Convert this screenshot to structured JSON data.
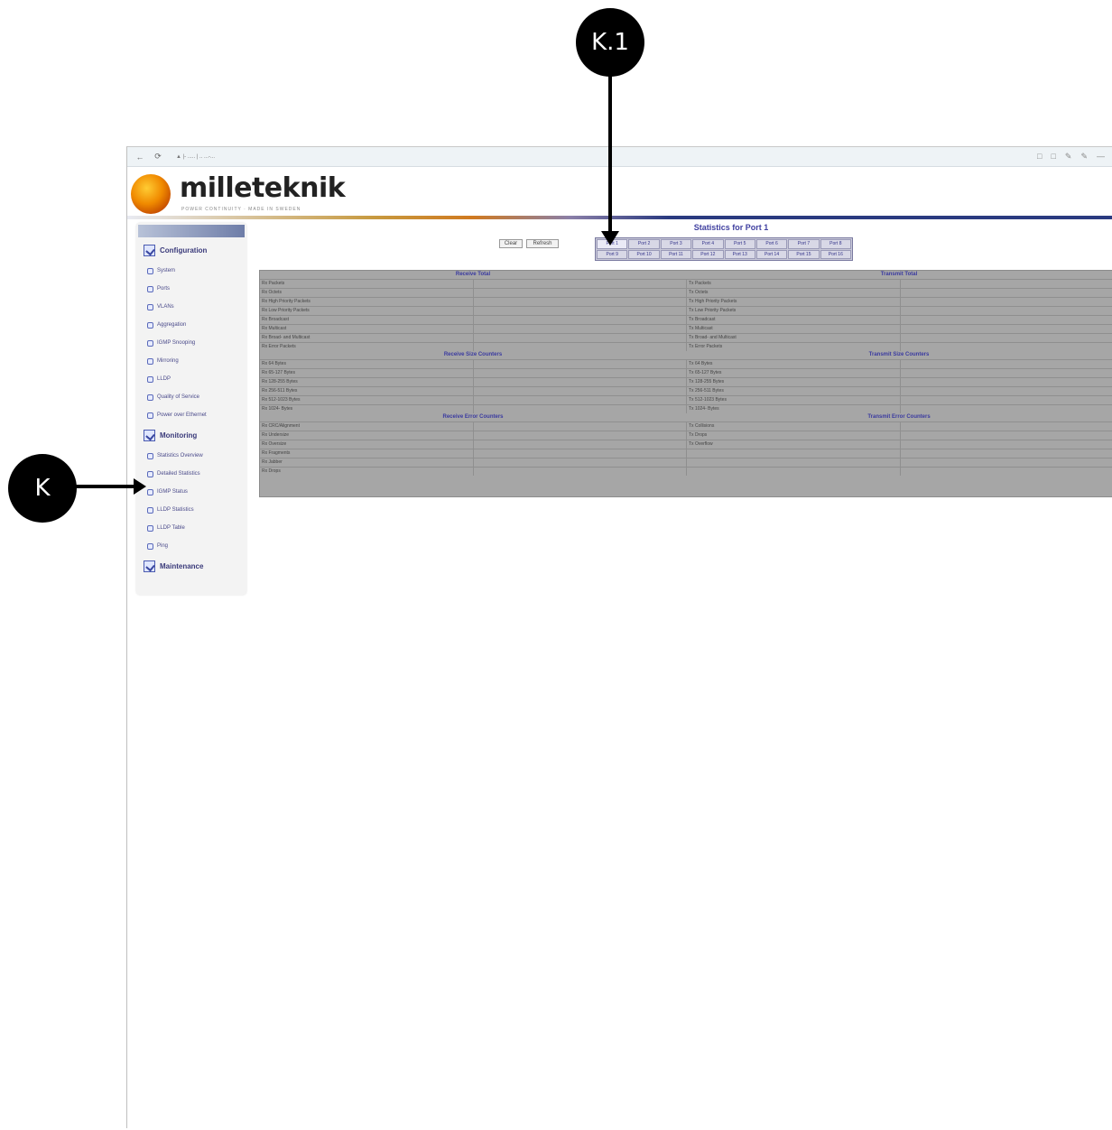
{
  "callouts": {
    "top": "K.1",
    "left": "K"
  },
  "browser": {
    "url_display": "▲ |- ..... | .. ...-...",
    "nav": [
      "←",
      "⟳"
    ],
    "right_icons": [
      "□",
      "□",
      "✎",
      "✎",
      "—"
    ]
  },
  "header": {
    "logo_text": "milleteknik",
    "tagline": "POWER CONTINUITY · MADE IN SWEDEN"
  },
  "sidebar": {
    "configuration_label": "Configuration",
    "config_items": [
      "System",
      "Ports",
      "VLANs",
      "Aggregation",
      "IGMP Snooping",
      "Mirroring",
      "LLDP",
      "Quality of Service",
      "Power over Ethernet"
    ],
    "monitoring_label": "Monitoring",
    "monitor_items": [
      "Statistics Overview",
      "Detailed Statistics",
      "IGMP Status",
      "LLDP Statistics",
      "LLDP Table",
      "Ping"
    ],
    "maintenance_label": "Maintenance"
  },
  "main": {
    "title": "Statistics for Port 1",
    "clear_label": "Clear",
    "refresh_label": "Refresh",
    "ports": [
      "Port 1",
      "Port 2",
      "Port 3",
      "Port 4",
      "Port 5",
      "Port 6",
      "Port 7",
      "Port 8",
      "Port 9",
      "Port 10",
      "Port 11",
      "Port 12",
      "Port 13",
      "Port 14",
      "Port 15",
      "Port 16"
    ],
    "sections": [
      {
        "left_title": "Receive Total",
        "right_title": "Transmit Total",
        "rows": [
          [
            "Rx Packets",
            "Tx Packets"
          ],
          [
            "Rx Octets",
            "Tx Octets"
          ],
          [
            "Rx High Priority Packets",
            "Tx High Priority Packets"
          ],
          [
            "Rx Low Priority Packets",
            "Tx Low Priority Packets"
          ],
          [
            "Rx Broadcast",
            "Tx Broadcast"
          ],
          [
            "Rx Multicast",
            "Tx Multicast"
          ],
          [
            "Rx Broad- and Multicast",
            "Tx Broad- and Multicast"
          ],
          [
            "Rx Error Packets",
            "Tx Error Packets"
          ]
        ]
      },
      {
        "left_title": "Receive Size Counters",
        "right_title": "Transmit Size Counters",
        "rows": [
          [
            "Rx 64 Bytes",
            "Tx 64 Bytes"
          ],
          [
            "Rx 65-127 Bytes",
            "Tx 65-127 Bytes"
          ],
          [
            "Rx 128-255 Bytes",
            "Tx 128-255 Bytes"
          ],
          [
            "Rx 256-511 Bytes",
            "Tx 256-511 Bytes"
          ],
          [
            "Rx 512-1023 Bytes",
            "Tx 512-1023 Bytes"
          ],
          [
            "Rx 1024- Bytes",
            "Tx 1024- Bytes"
          ]
        ]
      },
      {
        "left_title": "Receive Error Counters",
        "right_title": "Transmit Error Counters",
        "rows": [
          [
            "Rx CRC/Alignment",
            "Tx Collisions"
          ],
          [
            "Rx Undersize",
            "Tx Drops"
          ],
          [
            "Rx Oversize",
            "Tx Overflow"
          ],
          [
            "Rx Fragments",
            ""
          ],
          [
            "Rx Jabber",
            ""
          ],
          [
            "Rx Drops",
            ""
          ]
        ]
      }
    ]
  }
}
